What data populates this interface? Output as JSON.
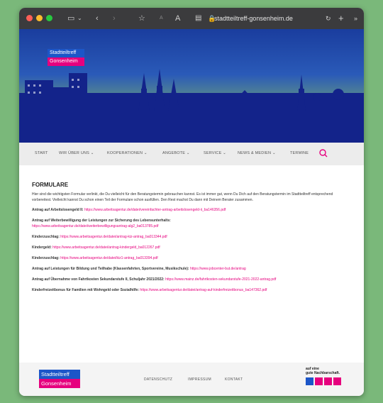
{
  "browser": {
    "url": "stadtteiltreff-gonsenheim.de",
    "icons": [
      "sidebar-icon",
      "chevron-down-icon",
      "back-icon",
      "forward-icon",
      "star-icon",
      "text-size-small-icon",
      "text-size-large-icon",
      "reader-icon",
      "lock-icon",
      "reload-icon",
      "new-tab-icon",
      "more-icon"
    ]
  },
  "site": {
    "logo_line1": "Stadtteiltreff",
    "logo_line2": "Gonsenheim"
  },
  "nav": {
    "items": [
      "START",
      "WIR ÜBER UNS ⌄",
      "KOOPERATIONEN ⌄",
      "ANGEBOTE ⌄",
      "SERVICE ⌄",
      "NEWS & MEDIEN ⌄",
      "TERMINE"
    ]
  },
  "content": {
    "title": "FORMULARE",
    "intro": "Hier sind die wichtigsten Formular verlinkt, die Du vielleicht für den Beratungstermin gebrauchen kannst. Es ist immer gut, wenn Du Dich auf den Beratungstermin im Stadtteiltreff entsprechend vorbereitest. Vielleicht kannst Du schon einen Teil der Formulare schon ausfüllen. Den Rest machst Du dann mit Deinem Berater zusammen.",
    "entries": [
      {
        "label": "Antrag auf Arbeitslosengeld II:",
        "link": "https://www.arbeitsagentur.de/datei/vereinfachter-antrag-arbeitslosengeld-ii_ba146356.pdf"
      },
      {
        "label": "Antrag auf Weiterbewilligung der Leistungen zur Sicherung des Lebensunterhalts:",
        "link": "https://www.arbeitsagentur.de/datei/weiterbewilligungsantrag-alg2_ba013785.pdf"
      },
      {
        "label": "Kinderzuschlag:",
        "link": "https://www.arbeitsagentur.de/datei/antrag-kiz-antrag_ba013344.pdf"
      },
      {
        "label": "Kindergeld:",
        "link": "https://www.arbeitsagentur.de/datei/antrag-kindergeld_ba012267.pdf"
      },
      {
        "label": "Kinderzuschlag:",
        "link": "https://www.arbeitsagentur.de/datei/kiz1-antrag_ba013394.pdf"
      },
      {
        "label": "Antrag auf Leistungen für Bildung und Teilhabe (Klassenfahrten, Sportvereine, Musikschule):",
        "link": "https://www.jobcenter-but.de/antrag"
      },
      {
        "label": "Antrag auf Übernahme von Fahrtkosten Sekundarstufe II, Schuljahr 2021/2022:",
        "link": "https://www.mainz.de/fahrtkosten-sekundarstufe-2021-2022-antrag.pdf"
      },
      {
        "label": "Kinderfreizeitbonus für Familien mit Wohngeld oder Sozialhilfe:",
        "link": "https://www.arbeitsagentur.de/datei/antrag-auf-kinderfreizeitbonus_ba147362.pdf"
      }
    ]
  },
  "footer": {
    "links": [
      "DATENSCHUTZ",
      "IMPRESSUM",
      "KONTAKT"
    ],
    "nachbar_line1": "auf eine",
    "nachbar_line2": "gute Nachbarschaft."
  },
  "colors": {
    "brand_blue": "#1c56c8",
    "brand_pink": "#e6007e",
    "sky_top": "#1a3d9e",
    "sky_bottom": "#b9d62c",
    "silhouette": "#13238a"
  }
}
